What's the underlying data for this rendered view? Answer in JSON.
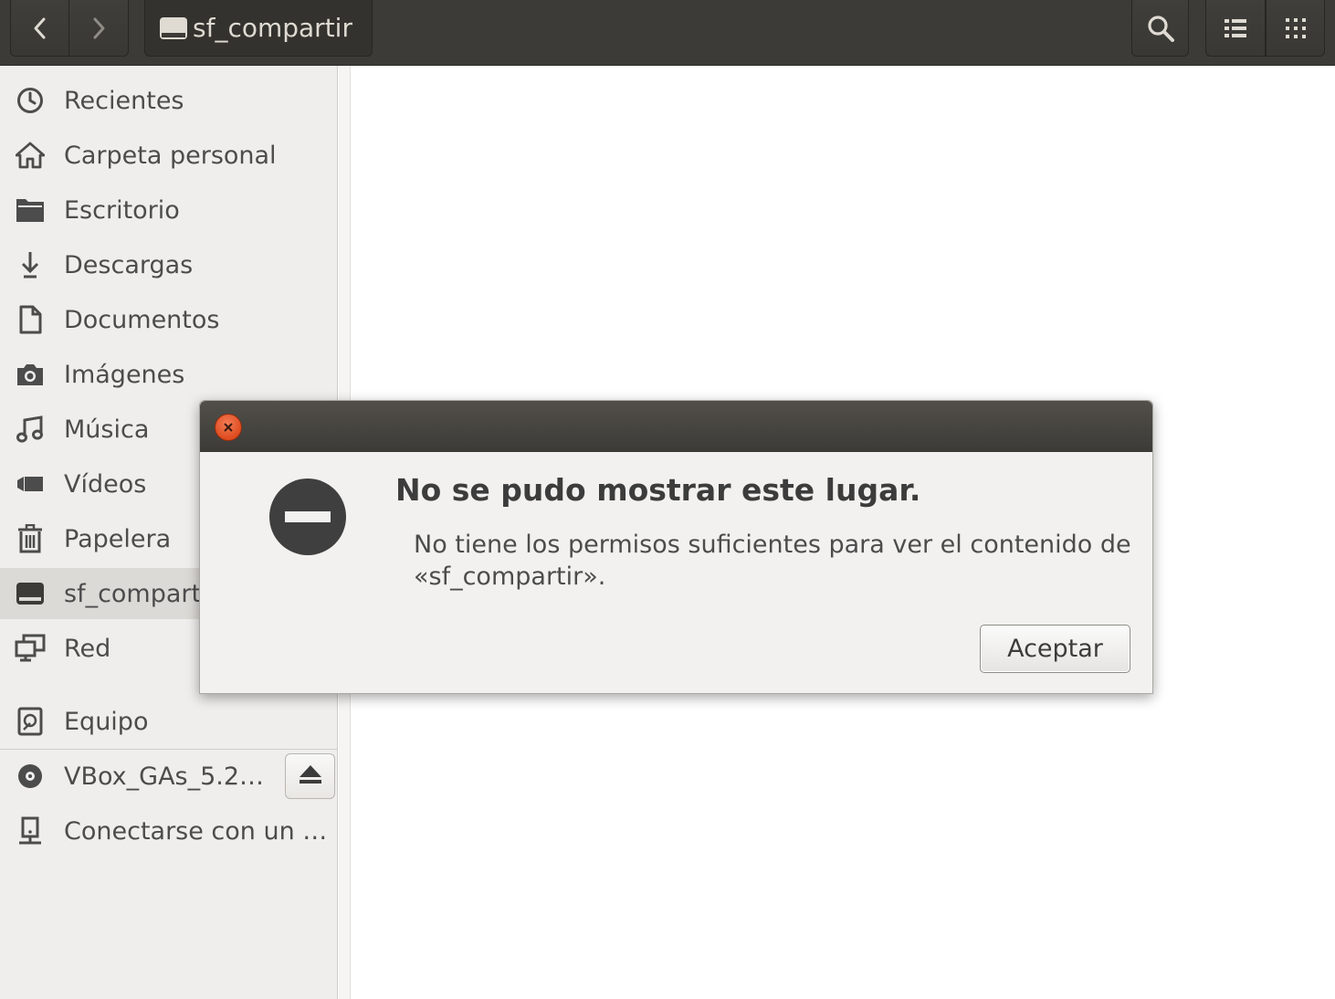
{
  "headerbar": {
    "back_icon": "chevron-left-icon",
    "forward_icon": "chevron-right-icon",
    "path_label": "sf_compartir",
    "path_icon": "drive-icon",
    "search_icon": "search-icon",
    "list_view_icon": "list-view-icon",
    "grid_view_icon": "grid-view-icon"
  },
  "sidebar": {
    "items": [
      {
        "label": "Recientes",
        "icon": "clock-icon"
      },
      {
        "label": "Carpeta personal",
        "icon": "home-icon"
      },
      {
        "label": "Escritorio",
        "icon": "folder-icon"
      },
      {
        "label": "Descargas",
        "icon": "download-icon"
      },
      {
        "label": "Documentos",
        "icon": "document-icon"
      },
      {
        "label": "Imágenes",
        "icon": "camera-icon"
      },
      {
        "label": "Música",
        "icon": "music-icon"
      },
      {
        "label": "Vídeos",
        "icon": "video-icon"
      },
      {
        "label": "Papelera",
        "icon": "trash-icon"
      },
      {
        "label": "sf_compartir",
        "icon": "drive-icon",
        "active": true
      },
      {
        "label": "Red",
        "icon": "network-icon"
      }
    ],
    "devices": [
      {
        "label": "Equipo",
        "icon": "computer-icon"
      },
      {
        "label": "VBox_GAs_5.2…",
        "icon": "disc-icon",
        "eject_icon": "eject-icon"
      },
      {
        "label": "Conectarse con un …",
        "icon": "server-icon"
      }
    ]
  },
  "dialog": {
    "close_icon": "close-icon",
    "status_icon": "no-entry-icon",
    "heading": "No se pudo mostrar este lugar.",
    "message": "No tiene los permisos suficientes para ver el contenido de «sf_compartir».",
    "ok_label": "Aceptar"
  },
  "colors": {
    "headerbar": "#3c3b37",
    "sidebar": "#efeeed",
    "sidebar_active": "#dcdad6",
    "dialog_close": "#df4b1f",
    "dialog_bg": "#f2f1f0"
  }
}
